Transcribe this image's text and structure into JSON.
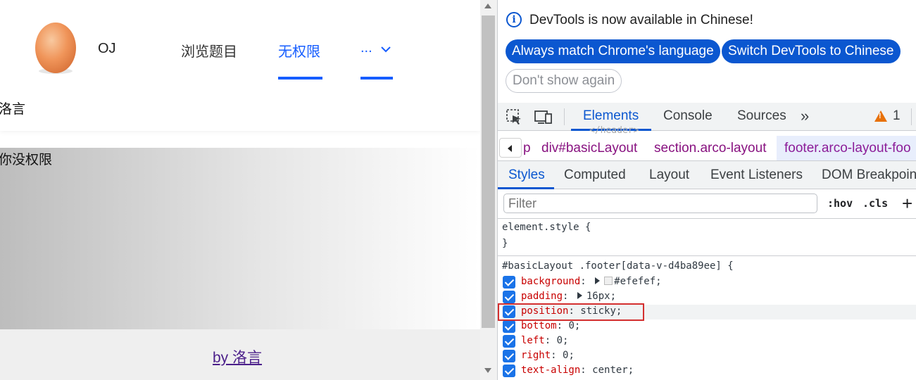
{
  "app": {
    "site_name": "OJ",
    "menu": [
      "浏览题目",
      "无权限"
    ],
    "menu_more": "...",
    "user_name": "洛言",
    "content_text": "你没权限",
    "footer_link": "by 洛言",
    "accent_color": "#165dff"
  },
  "devtools": {
    "banner": {
      "text": "DevTools is now available in Chinese!",
      "btn_match": "Always match Chrome's language",
      "btn_switch": "Switch DevTools to Chinese",
      "btn_dismiss": "Don't show again"
    },
    "tabs": [
      "Elements",
      "Console",
      "Sources"
    ],
    "more_tabs": "»",
    "warning_count": "1",
    "ghost_tag": "</header>",
    "breadcrumbs": [
      "p",
      "div#basicLayout",
      "section.arco-layout",
      "footer.arco-layout-foo"
    ],
    "subtabs": [
      "Styles",
      "Computed",
      "Layout",
      "Event Listeners",
      "DOM Breakpoin"
    ],
    "filter_placeholder": "Filter",
    "hov": ":hov",
    "cls": ".cls",
    "plus": "+",
    "element_style": "element.style {",
    "close_brace": "}",
    "selector": "#basicLayout .footer[data-v-d4ba89ee] {",
    "declarations": [
      {
        "prop": "background",
        "sep": ": ",
        "value": "#efefef;"
      },
      {
        "prop": "padding",
        "sep": ": ",
        "value": "16px;"
      },
      {
        "prop": "position",
        "sep": ": ",
        "value": "sticky;"
      },
      {
        "prop": "bottom",
        "sep": ": ",
        "value": "0;"
      },
      {
        "prop": "left",
        "sep": ": ",
        "value": "0;"
      },
      {
        "prop": "right",
        "sep": ": ",
        "value": "0;"
      },
      {
        "prop": "text-align",
        "sep": ": ",
        "value": "center;"
      }
    ],
    "accent_color": "#0b57d0"
  }
}
